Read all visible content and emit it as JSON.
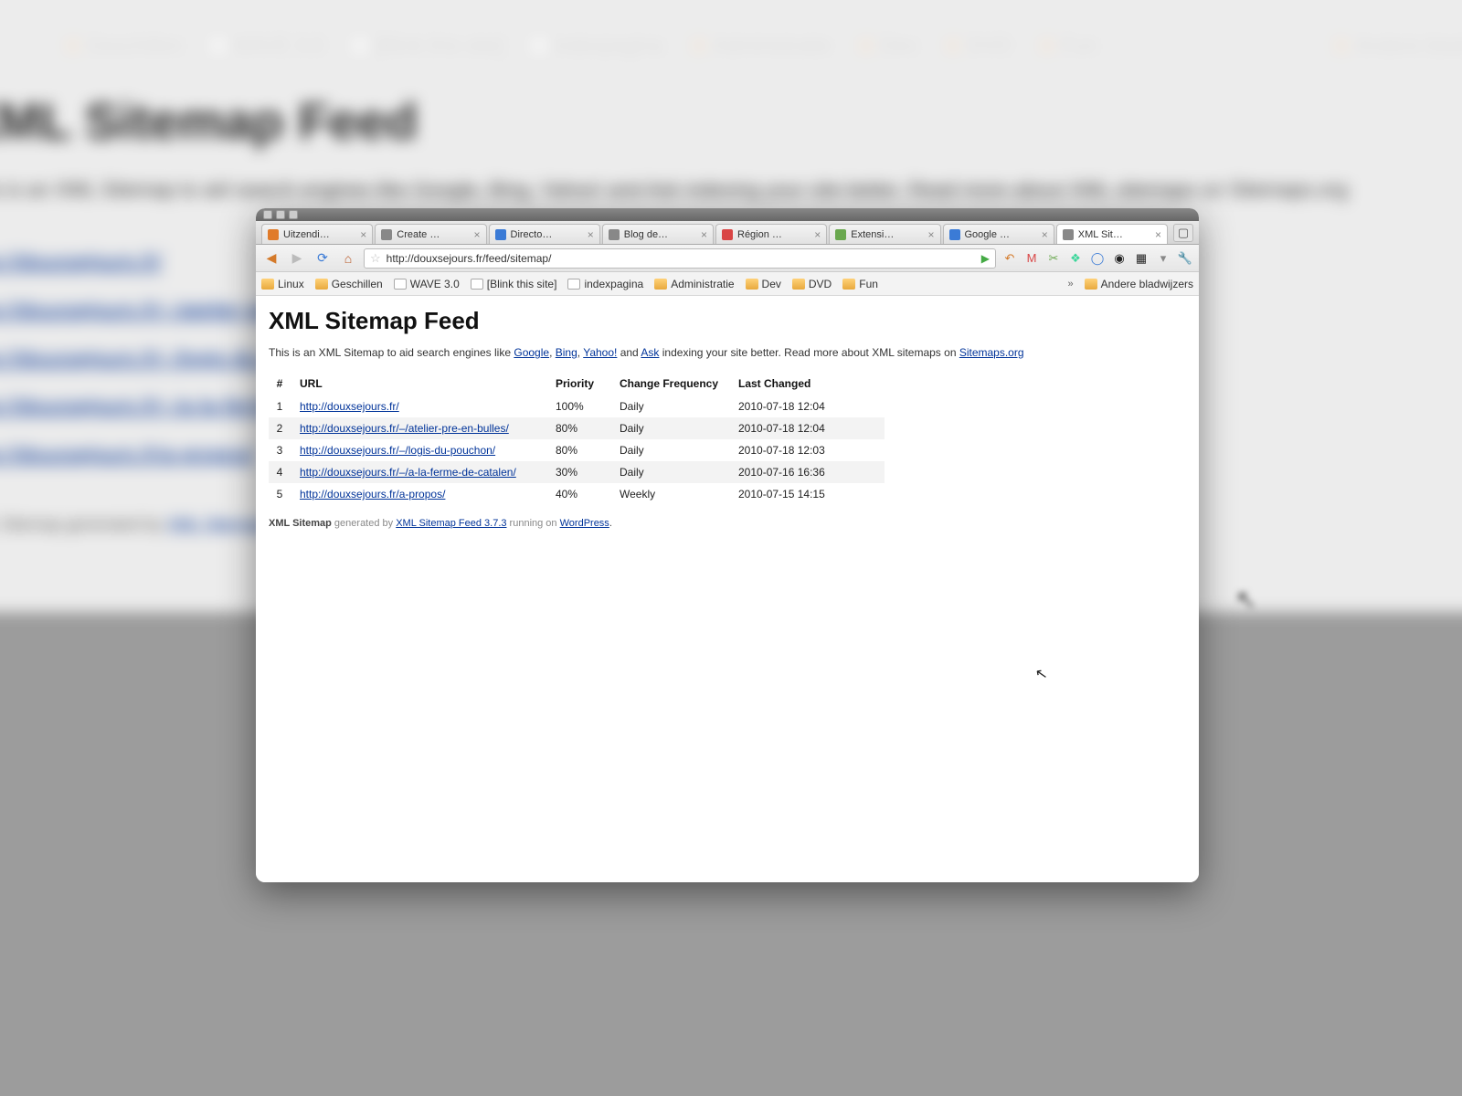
{
  "bgTitle": "XML Sitemap Feed",
  "bgDesc": "This is an XML Sitemap to aid search engines like Google, Bing, Yahoo! and Ask indexing your site better. Read more about XML sitemaps on Sitemaps.org",
  "bgBookmarks": [
    "Geschillen",
    "WAVE 3.0",
    "[Blink this site]",
    "indexpagina",
    "Administratie",
    "Dev",
    "DVD",
    "Fun",
    "Andere bladwij…"
  ],
  "tabs": [
    {
      "label": "Uitzendi…",
      "color": "#e07b2a"
    },
    {
      "label": "Create …",
      "color": "#888"
    },
    {
      "label": "Directo…",
      "color": "#3b7bd6"
    },
    {
      "label": "Blog de…",
      "color": "#888"
    },
    {
      "label": "Région …",
      "color": "#d94545"
    },
    {
      "label": "Extensi…",
      "color": "#6aa84f"
    },
    {
      "label": "Google …",
      "color": "#3b7bd6"
    },
    {
      "label": "XML Sit…",
      "color": "#888",
      "active": true
    }
  ],
  "url": "http://douxsejours.fr/feed/sitemap/",
  "toolbarIcons": [
    "↶",
    "M",
    "✂",
    "❖",
    "◯",
    "◉",
    "▦",
    "▾",
    "🔧"
  ],
  "bookmarks": [
    {
      "label": "Linux",
      "type": "folder"
    },
    {
      "label": "Geschillen",
      "type": "folder"
    },
    {
      "label": "WAVE 3.0",
      "type": "page"
    },
    {
      "label": "[Blink this site]",
      "type": "page"
    },
    {
      "label": "indexpagina",
      "type": "page"
    },
    {
      "label": "Administratie",
      "type": "folder"
    },
    {
      "label": "Dev",
      "type": "folder"
    },
    {
      "label": "DVD",
      "type": "folder"
    },
    {
      "label": "Fun",
      "type": "folder"
    }
  ],
  "overflowLabel": "Andere bladwijzers",
  "page": {
    "title": "XML Sitemap Feed",
    "intro_pre": "This is an XML Sitemap to aid search engines like ",
    "links": {
      "google": "Google",
      "bing": "Bing",
      "yahoo": "Yahoo!",
      "ask": "Ask",
      "sitemaps": "Sitemaps.org"
    },
    "intro_mid1": ", ",
    "intro_mid2": ", ",
    "intro_mid3": " and ",
    "intro_post": " indexing your site better. Read more about XML sitemaps on ",
    "headers": {
      "num": "#",
      "url": "URL",
      "priority": "Priority",
      "freq": "Change Frequency",
      "changed": "Last Changed"
    },
    "rows": [
      {
        "n": "1",
        "url": "http://douxsejours.fr/",
        "pri": "100%",
        "freq": "Daily",
        "date": "2010-07-18 12:04"
      },
      {
        "n": "2",
        "url": "http://douxsejours.fr/–/atelier-pre-en-bulles/",
        "pri": "80%",
        "freq": "Daily",
        "date": "2010-07-18 12:04"
      },
      {
        "n": "3",
        "url": "http://douxsejours.fr/–/logis-du-pouchon/",
        "pri": "80%",
        "freq": "Daily",
        "date": "2010-07-18 12:03"
      },
      {
        "n": "4",
        "url": "http://douxsejours.fr/–/a-la-ferme-de-catalen/",
        "pri": "30%",
        "freq": "Daily",
        "date": "2010-07-16 16:36"
      },
      {
        "n": "5",
        "url": "http://douxsejours.fr/a-propos/",
        "pri": "40%",
        "freq": "Weekly",
        "date": "2010-07-15 14:15"
      }
    ],
    "footer": {
      "strong": "XML Sitemap",
      "gen": " generated by ",
      "plugin": "XML Sitemap Feed 3.7.3",
      "run": " running on ",
      "wp": "WordPress",
      "dot": "."
    }
  }
}
